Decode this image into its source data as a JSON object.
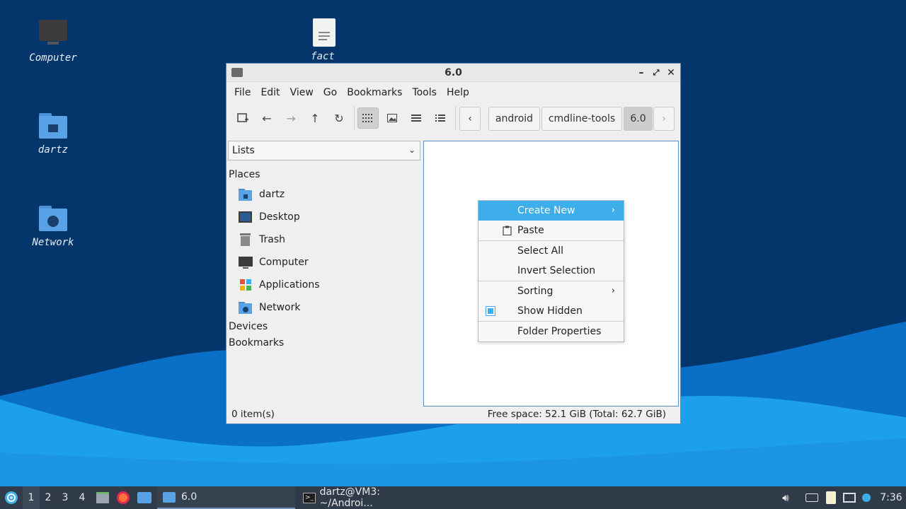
{
  "desktop": {
    "icons": [
      {
        "label": "Computer",
        "icon": "computer-icon"
      },
      {
        "label": "fact",
        "icon": "text-file-icon"
      },
      {
        "label": "dartz",
        "icon": "home-folder-icon"
      },
      {
        "label": "Network",
        "icon": "network-folder-icon"
      }
    ]
  },
  "window": {
    "title": "6.0",
    "menu": [
      "File",
      "Edit",
      "View",
      "Go",
      "Bookmarks",
      "Tools",
      "Help"
    ],
    "breadcrumbs": [
      "android",
      "cmdline-tools",
      "6.0"
    ],
    "sidebar": {
      "selector": "Lists",
      "sections": {
        "places": "Places",
        "devices": "Devices",
        "bookmarks": "Bookmarks"
      },
      "places": [
        {
          "label": "dartz",
          "icon": "home-folder-icon"
        },
        {
          "label": "Desktop",
          "icon": "desktop-icon"
        },
        {
          "label": "Trash",
          "icon": "trash-icon"
        },
        {
          "label": "Computer",
          "icon": "computer-icon"
        },
        {
          "label": "Applications",
          "icon": "applications-icon"
        },
        {
          "label": "Network",
          "icon": "network-folder-icon"
        }
      ]
    },
    "status": {
      "items": "0 item(s)",
      "free_space": "Free space: 52.1 GiB (Total: 62.7 GiB)"
    }
  },
  "context_menu": {
    "create_new": "Create New",
    "paste": "Paste",
    "select_all": "Select All",
    "invert_selection": "Invert Selection",
    "sorting": "Sorting",
    "show_hidden": "Show Hidden",
    "show_hidden_checked": true,
    "folder_properties": "Folder Properties"
  },
  "taskbar": {
    "workspaces": [
      "1",
      "2",
      "3",
      "4"
    ],
    "active_workspace": "1",
    "tasks": [
      {
        "label": "6.0",
        "icon": "folder-icon"
      },
      {
        "label": "dartz@VM3: ~/Androi...",
        "icon": "terminal-icon"
      }
    ],
    "clock": "7:36"
  },
  "colors": {
    "accent": "#3daee9",
    "taskbar": "#2f3b48",
    "desktop": "#05366b"
  }
}
